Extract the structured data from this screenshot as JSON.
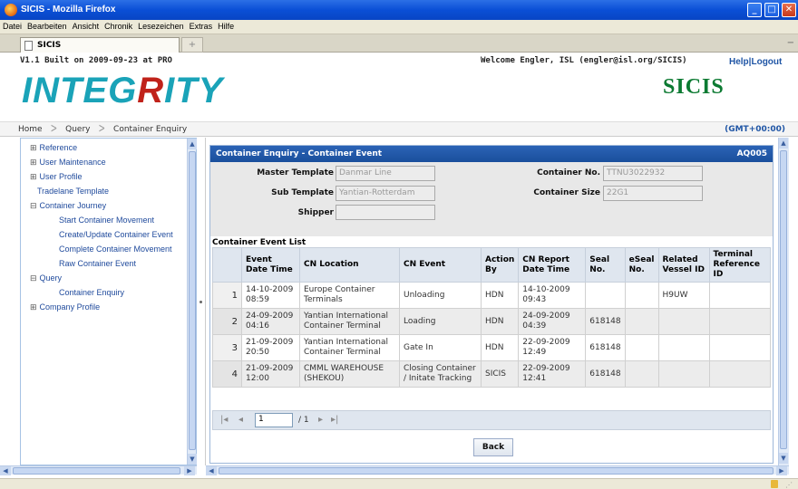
{
  "window": {
    "title": "SICIS - Mozilla Firefox"
  },
  "menu": [
    "Datei",
    "Bearbeiten",
    "Ansicht",
    "Chronik",
    "Lesezeichen",
    "Extras",
    "Hilfe"
  ],
  "tab": {
    "label": "SICIS",
    "new_tab": "+"
  },
  "header": {
    "build": "V1.1 Built on 2009-09-23 at PRO",
    "welcome": "Welcome Engler, ISL (engler@isl.org/SICIS)",
    "help": "Help",
    "separator": "|",
    "logout": "Logout",
    "logo_prefix": "INTEG",
    "logo_mid": "R",
    "logo_suffix": "ITY",
    "brand": "SICIS"
  },
  "breadcrumb": {
    "items": [
      "Home",
      "Query",
      "Container Enquiry"
    ],
    "timezone": "(GMT+00:00)"
  },
  "sidebar": {
    "items": [
      {
        "label": "Reference",
        "toggle": "⊞"
      },
      {
        "label": "User Maintenance",
        "toggle": "⊞"
      },
      {
        "label": "User Profile",
        "toggle": "⊞"
      },
      {
        "label": "Tradelane Template",
        "toggle": ""
      },
      {
        "label": "Container Journey",
        "toggle": "⊟"
      },
      {
        "label": "Start Container Movement",
        "toggle": ""
      },
      {
        "label": "Create/Update Container Event",
        "toggle": ""
      },
      {
        "label": "Complete Container Movement",
        "toggle": ""
      },
      {
        "label": "Raw Container Event",
        "toggle": ""
      },
      {
        "label": "Query",
        "toggle": "⊟"
      },
      {
        "label": "Container Enquiry",
        "toggle": ""
      },
      {
        "label": "Company Profile",
        "toggle": "⊞"
      }
    ]
  },
  "panel": {
    "title": "Container Enquiry - Container Event",
    "code": "AQ005",
    "master_template_label": "Master Template",
    "master_template_value": "Danmar Line",
    "sub_template_label": "Sub Template",
    "sub_template_value": "Yantian-Rotterdam",
    "shipper_label": "Shipper",
    "shipper_value": "",
    "container_no_label": "Container No.",
    "container_no_value": "TTNU3022932",
    "container_size_label": "Container Size",
    "container_size_value": "22G1",
    "list_label": "Container Event List"
  },
  "table": {
    "headers": [
      "",
      "Event Date Time",
      "CN Location",
      "CN Event",
      "Action By",
      "CN Report Date Time",
      "Seal No.",
      "eSeal No.",
      "Related Vessel ID",
      "Terminal Reference ID"
    ],
    "rows": [
      [
        "1",
        "14-10-2009 08:59",
        "Europe Container Terminals",
        "Unloading",
        "HDN",
        "14-10-2009 09:43",
        "",
        "",
        "H9UW",
        ""
      ],
      [
        "2",
        "24-09-2009 04:16",
        "Yantian International Container Terminal",
        "Loading",
        "HDN",
        "24-09-2009 04:39",
        "618148",
        "",
        "",
        ""
      ],
      [
        "3",
        "21-09-2009 20:50",
        "Yantian International Container Terminal",
        "Gate In",
        "HDN",
        "22-09-2009 12:49",
        "618148",
        "",
        "",
        ""
      ],
      [
        "4",
        "21-09-2009 12:00",
        "CMML WAREHOUSE (SHEKOU)",
        "Closing Container / Initate Tracking",
        "SICIS",
        "22-09-2009 12:41",
        "618148",
        "",
        "",
        ""
      ]
    ]
  },
  "pager": {
    "page": "1",
    "of": "/ 1"
  },
  "buttons": {
    "back": "Back"
  }
}
